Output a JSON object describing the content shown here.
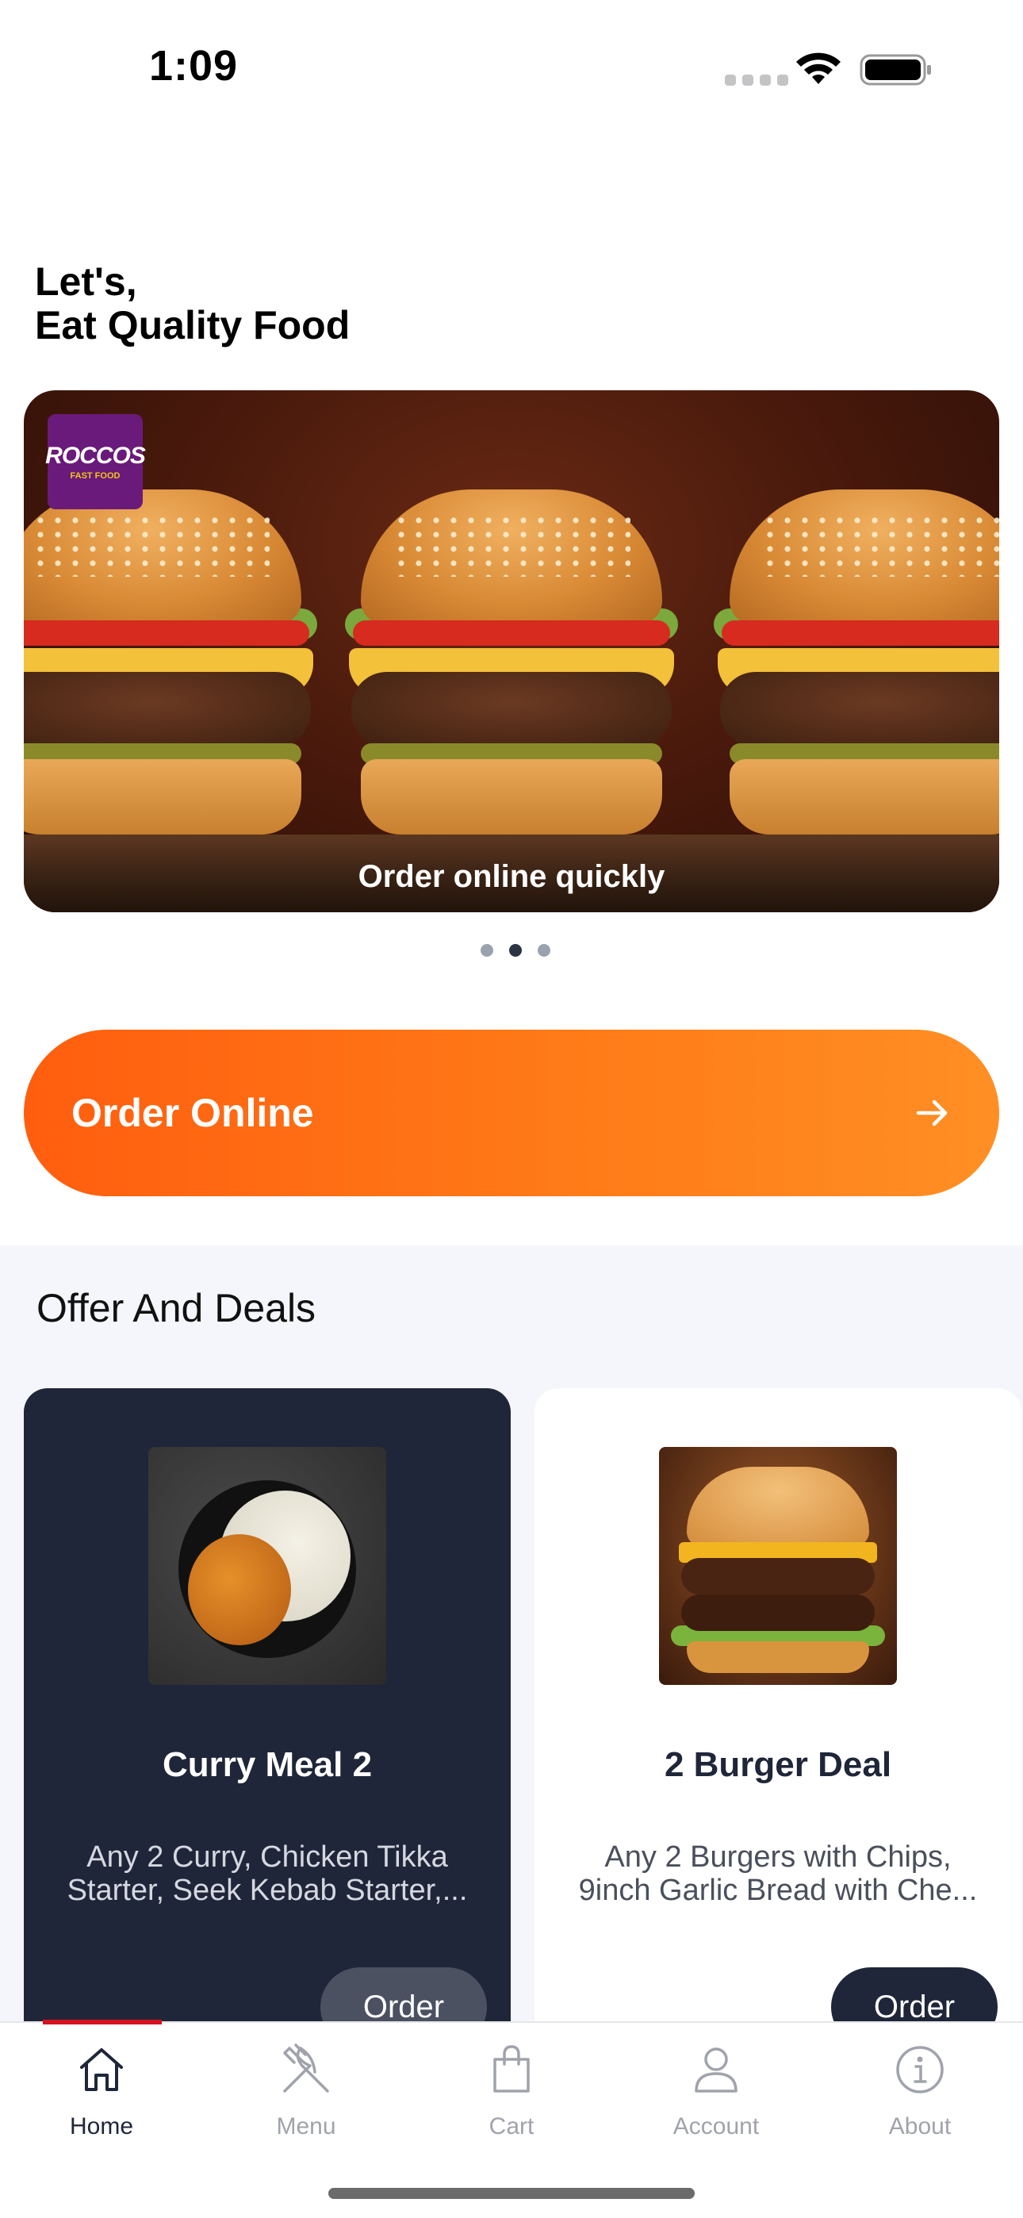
{
  "status_bar": {
    "time": "1:09"
  },
  "headline": {
    "line1": "Let's,",
    "line2": "Eat Quality Food"
  },
  "banner": {
    "caption": "Order online quickly",
    "logo_main": "ROCCOS",
    "logo_sub": "FAST FOOD",
    "active_slide": 2,
    "slide_count": 3
  },
  "order_online": {
    "label": "Order Online",
    "icon": "arrow-right-icon"
  },
  "offers": {
    "title": "Offer And Deals",
    "items": [
      {
        "title": "Curry Meal 2",
        "description": "Any 2 Curry, Chicken Tikka Starter, Seek Kebab Starter,...",
        "button": "Order"
      },
      {
        "title": "2 Burger Deal",
        "description": "Any 2 Burgers with Chips, 9inch Garlic Bread with Che...",
        "button": "Order"
      }
    ]
  },
  "tab_bar": {
    "active": "Home",
    "tabs": [
      {
        "label": "Home",
        "icon": "home-icon"
      },
      {
        "label": "Menu",
        "icon": "fork-knife-icon"
      },
      {
        "label": "Cart",
        "icon": "shopping-bag-icon"
      },
      {
        "label": "Account",
        "icon": "user-icon"
      },
      {
        "label": "About",
        "icon": "info-icon"
      }
    ]
  },
  "colors": {
    "accent_orange": "#ff6a10",
    "navy": "#1f2639",
    "active_tab_indicator": "#d3121e"
  }
}
